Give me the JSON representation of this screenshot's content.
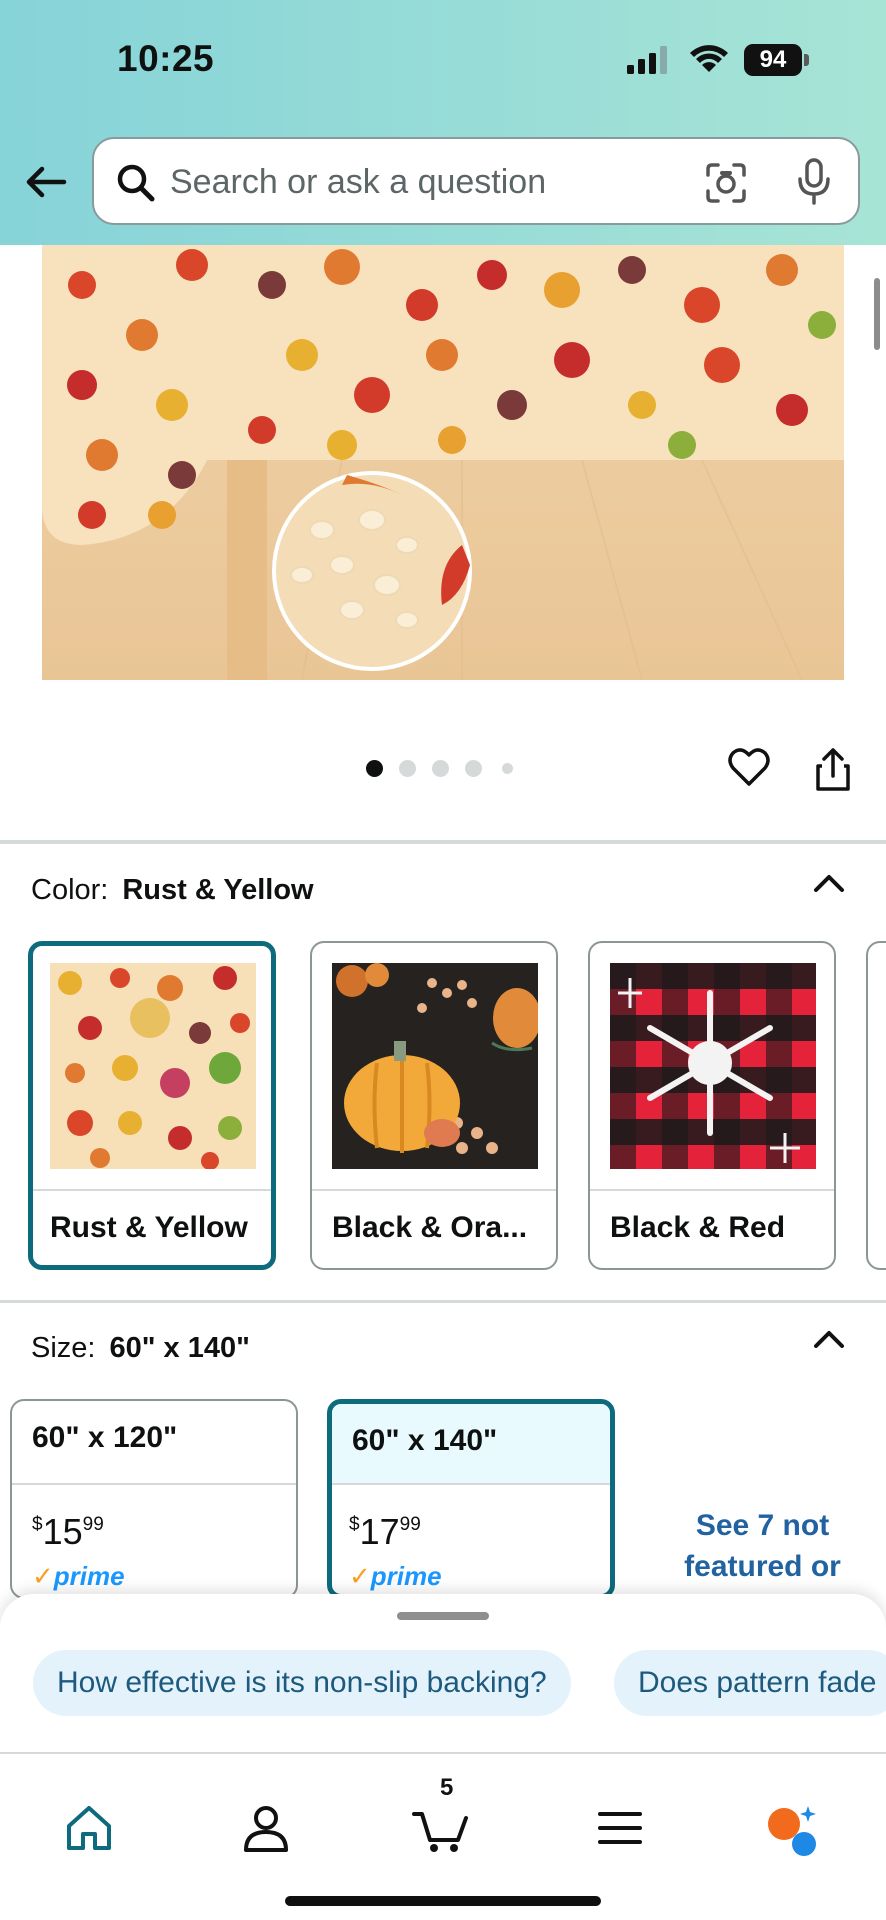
{
  "status_bar": {
    "time": "10:25",
    "battery": "94"
  },
  "search": {
    "placeholder": "Search or ask a question",
    "icons": [
      "back-arrow-icon",
      "search-icon",
      "camera-lens-icon",
      "microphone-icon"
    ]
  },
  "gallery": {
    "image_count": 5,
    "active_index": 0,
    "actions": [
      "heart-icon",
      "share-icon"
    ]
  },
  "color": {
    "label": "Color:",
    "selected": "Rust & Yellow",
    "options": [
      {
        "name": "Rust & Yellow"
      },
      {
        "name": "Black & Ora..."
      },
      {
        "name": "Black & Red"
      }
    ]
  },
  "size": {
    "label": "Size:",
    "selected": "60\" x 140\"",
    "options": [
      {
        "name": "60\" x 120\"",
        "currency": "$",
        "whole": "15",
        "fraction": "99",
        "prime": "prime"
      },
      {
        "name": "60\" x 140\"",
        "currency": "$",
        "whole": "17",
        "fraction": "99",
        "prime": "prime"
      }
    ],
    "see_more": "See 7 not featured or"
  },
  "questions": [
    "How effective is its non-slip backing?",
    "Does pattern fade"
  ],
  "tabbar": {
    "items": [
      "home-icon",
      "account-icon",
      "cart-icon",
      "menu-icon",
      "rufus-icon"
    ],
    "cart_count": "5"
  },
  "colors": {
    "accent": "#0d6b7d",
    "link": "#2162a1",
    "prime": "#1a98ff",
    "header_start": "#86d3d8",
    "header_end": "#a7e4d6"
  }
}
